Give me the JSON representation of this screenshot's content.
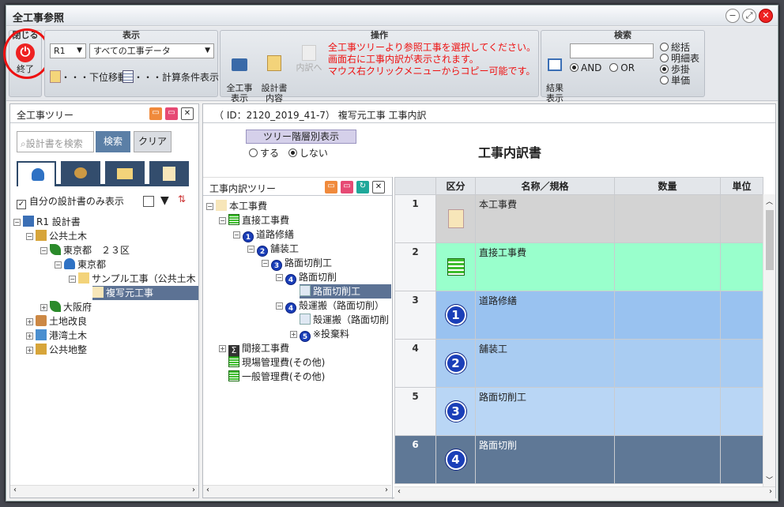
{
  "window": {
    "title": "全工事参照"
  },
  "ribbon": {
    "close": {
      "group_label": "閉じる",
      "button_label": "終了"
    },
    "display": {
      "group_label": "表示",
      "year_select": "R1",
      "data_select": "すべての工事データ",
      "move_down_label": "・・・下位移動",
      "calc_conditions_label": "・・・計算条件表示"
    },
    "operation": {
      "group_label": "操作",
      "all_work_label": "全工事\n表示",
      "design_content_label": "設計書\n内容",
      "breakdown_label": "内訳へ",
      "message_lines": [
        "全工事ツリーより参照工事を選択してください。",
        "画面右に工事内訳が表示されます。",
        "マウス右クリックメニューからコピー可能です。"
      ]
    },
    "search": {
      "group_label": "検索",
      "result_label": "結果\n表示",
      "input_value": "",
      "and_label": "AND",
      "or_label": "OR",
      "options": [
        "総括",
        "明細表",
        "歩掛",
        "単価"
      ],
      "selected_option": "歩掛"
    }
  },
  "left_panel": {
    "title": "全工事ツリー",
    "search_placeholder": "設計書を検索",
    "search_button": "検索",
    "clear_button": "クリア",
    "own_only_label": "自分の設計書のみ表示",
    "tree": [
      {
        "label": "R1 設計書",
        "icon": "document-icon"
      },
      {
        "label": "公共土木",
        "icon": "construction-icon"
      },
      {
        "label": "東京都　２３区",
        "icon": "pen-icon"
      },
      {
        "label": "東京都",
        "icon": "person-icon"
      },
      {
        "label": "サンプル工事（公共土木",
        "icon": "folder-document-icon"
      },
      {
        "label": "複写元工事",
        "icon": "person-document-icon"
      },
      {
        "label": "大阪府",
        "icon": "pen-icon"
      },
      {
        "label": "土地改良",
        "icon": "farm-icon"
      },
      {
        "label": "港湾土木",
        "icon": "harbor-icon"
      },
      {
        "label": "公共地整",
        "icon": "construction-icon"
      }
    ]
  },
  "right_panel": {
    "header": "（ ID：2120_2019_41-7）  複写元工事 工事内訳",
    "tree_level_button": "ツリー階層別表示",
    "yes_label": "する",
    "no_label": "しない",
    "doc_title": "工事内訳書"
  },
  "breakdown_tree": {
    "title": "工事内訳ツリー",
    "nodes": [
      {
        "label": "本工事費"
      },
      {
        "label": "直接工事費"
      },
      {
        "label": "道路修繕",
        "num": "1"
      },
      {
        "label": "舗装工",
        "num": "2"
      },
      {
        "label": "路面切削工",
        "num": "3"
      },
      {
        "label": "路面切削",
        "num": "4"
      },
      {
        "label": "路面切削工"
      },
      {
        "label": "殻運搬（路面切削）",
        "num": "4"
      },
      {
        "label": "殻運搬（路面切削"
      },
      {
        "label": "※投棄料",
        "num": "5"
      },
      {
        "label": "間接工事費"
      },
      {
        "label": "現場管理費(その他)"
      },
      {
        "label": "一般管理費(その他)"
      }
    ]
  },
  "grid": {
    "headers": [
      "",
      "区分",
      "名称／規格",
      "数量",
      "単位"
    ],
    "rows": [
      {
        "no": "1",
        "kind": "person",
        "name": "本工事費",
        "color": "#d3d3d3"
      },
      {
        "no": "2",
        "kind": "green",
        "name": "直接工事費",
        "color": "#99ffcc"
      },
      {
        "no": "3",
        "kind": "1",
        "name": "道路修繕",
        "color": "#99c2f0"
      },
      {
        "no": "4",
        "kind": "2",
        "name": "舗装工",
        "color": "#a9ccf2"
      },
      {
        "no": "5",
        "kind": "3",
        "name": "路面切削工",
        "color": "#b9d6f5"
      },
      {
        "no": "6",
        "kind": "4",
        "name": "路面切削",
        "color": "#5f7896"
      }
    ]
  },
  "colors": {
    "selected_row": "#5c7294",
    "accent_red": "#e11"
  }
}
